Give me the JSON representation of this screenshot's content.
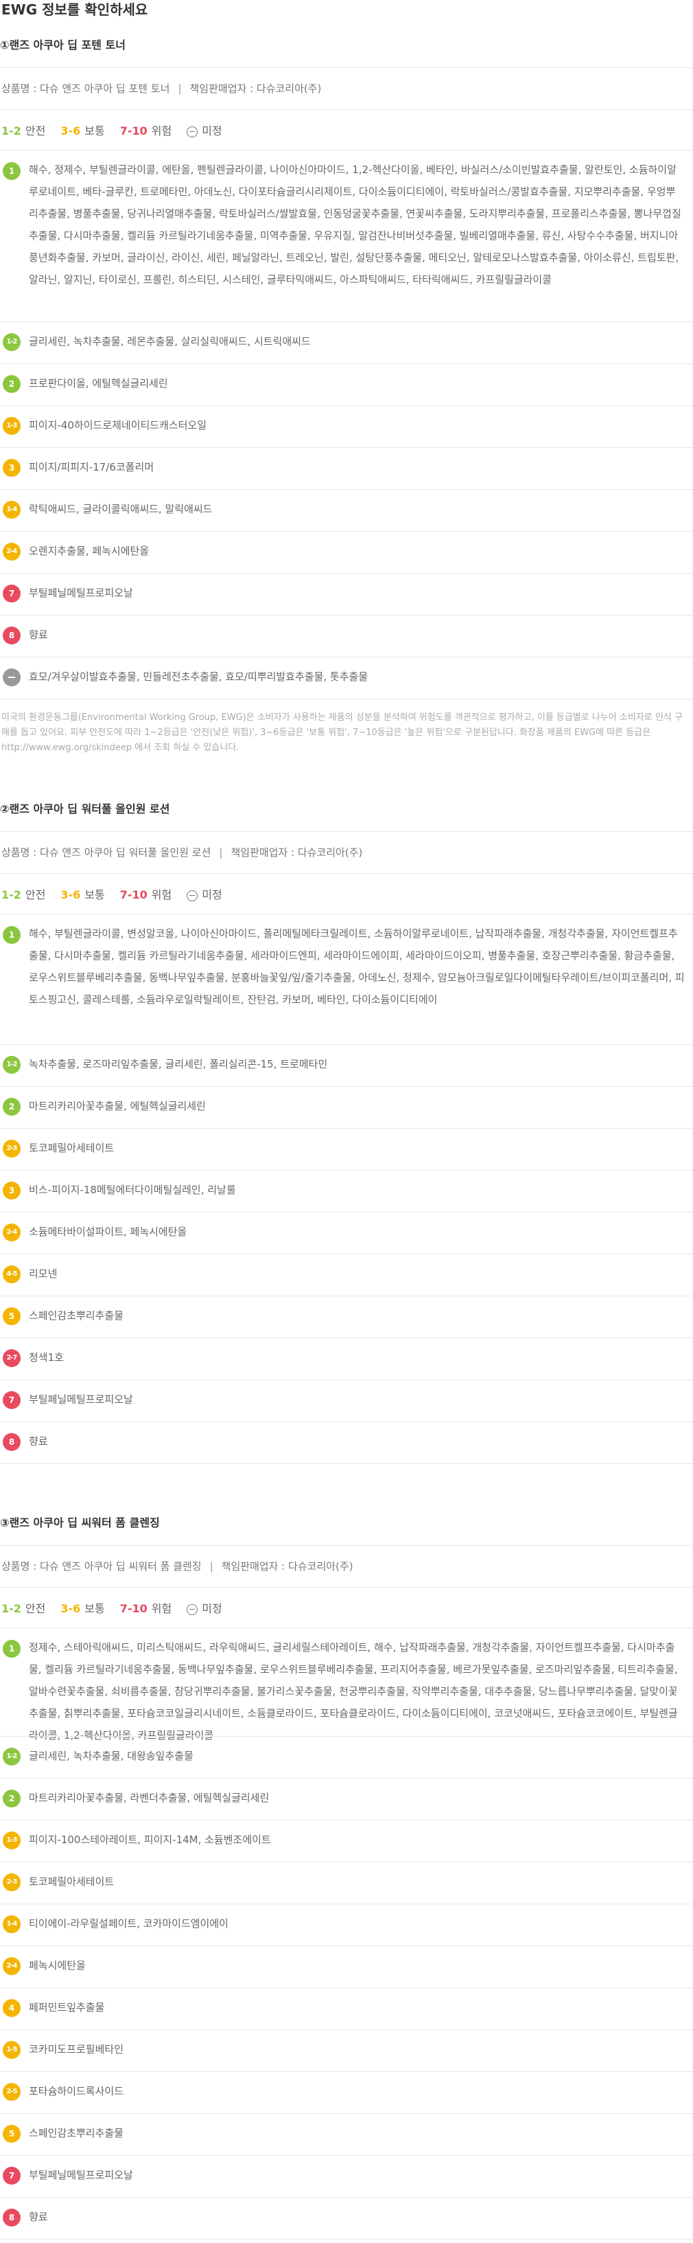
{
  "page_title": "EWG 정보를 확인하세요",
  "legend": {
    "g1": "1-2",
    "g1_label": "안전",
    "g2": "3-6",
    "g2_label": "보통",
    "g3": "7-10",
    "g3_label": "위험",
    "g4_label": "미정"
  },
  "colors": {
    "safe": "#8cc63f",
    "moderate": "#f4b400",
    "danger": "#e84a5f",
    "unknown": "#999999"
  },
  "products": [
    {
      "title": "①랜즈 아쿠아 딥 포텐 토너",
      "product_label": "상품명 : 다슈 앤즈 아쿠아 딥 포텐 토너",
      "seller_label": "책임판매업자 : 다슈코리아(주)",
      "rows": [
        {
          "grade": "1",
          "text": "해수, 정제수, 부틸렌글라이콜, 에탄올, 펜틸렌글라이콜, 나이아신아마이드, 1,2-헥산다이올, 베타인, 바실러스/소이빈발효추출물, 알란토인, 소듐하이알루로네이트, 베타-글루칸, 트로메타민, 아데노신, 다이포타슘글리시리제이트, 다이소듐이디티에이, 락토바실러스/콩발효추출물, 지모뿌리추출물, 우엉뿌리추출물, 병풀추출물, 당귀나리열매추출물, 락토바실러스/쌀발효물, 인동덩굴꽃추출물, 연꽃씨추출물, 도라지뿌리추출물, 프로폴리스추출물, 뽕나무껍질추출물, 다시마추출물, 켈리듐 카르틸라기네움추출물, 미역추출물, 우유지질, 말검잔나비버섯추출물, 빌베리열매추출물, 류신, 사탕수수추출물, 버지니아풍년화추출물, 카보머, 글라이신, 라이신, 세린, 페닐알라닌, 트레오닌, 발린, 설탕단풍추출물, 메티오닌, 알테로모나스발효추출물, 아이소류신, 트립토판, 알라닌, 알지닌, 타이로신, 프롤린, 히스티딘, 시스테인, 글루타믹애씨드, 아스파틱애씨드, 타타릭애씨드, 카프릴릴글라이콜"
        },
        {
          "grade": "1-2",
          "text": "글리세린, 녹차추출물, 레몬추출물, 살리실릭애씨드, 시트릭애씨드"
        },
        {
          "grade": "2",
          "text": "프로판다이올, 에틸헥실글리세린"
        },
        {
          "grade": "1-3",
          "text": "피이지-40하이드로제네이티드캐스터오일"
        },
        {
          "grade": "3",
          "text": "피이지/피피지-17/6코폴리머"
        },
        {
          "grade": "1-4",
          "text": "락틱애씨드, 글라이콜릭애씨드, 말릭애씨드"
        },
        {
          "grade": "2-4",
          "text": "오렌지추출물, 페녹시에탄올"
        },
        {
          "grade": "7",
          "text": "부틸페닐메틸프로피오날"
        },
        {
          "grade": "8",
          "text": "향료"
        },
        {
          "grade": "na",
          "text": "효모/겨우살이발효추출물, 민들레전초추출물, 효모/띠뿌리발효추출물, 톳추출물"
        }
      ],
      "disclaimer": "미국의 환경운동그룹(Environmental Working Group, EWG)은 소비자가 사용하는 제품의 성분을 분석하여 위험도를 객관적으로 평가하고, 이를 등급별로 나누어 소비자로 인식 구매를 돕고 있어요. 피부 안전도에 따라 1~2등급은 '안전(낮은 위험)', 3~6등급은 '보통 위험', 7~10등급은 '높은 위험'으로 구분된답니다. 화장품 제품의 EWG에 따른 등급은 http://www.ewg.org/skindeep 에서 조회 하실 수 있습니다."
    },
    {
      "title": "②랜즈 아쿠아 딥 워터풀 올인원 로션",
      "product_label": "상품명 : 다슈 앤즈 아쿠아 딥 워터풀 올인원 로션",
      "seller_label": "책임판매업자 : 다슈코리아(주)",
      "rows": [
        {
          "grade": "1",
          "text": "해수, 부틸렌글라이콜, 변성알코올, 나이아신아마이드, 폴리메틸메타크릴레이트, 소듐하이알루로네이트, 납작파래추출물, 개청각추출물, 자이언트켈프추출물, 다시마추출물, 켈리듐 카르틸라기네움추출물, 세라마이드엔피, 세라마이드에이피, 세라마이드이오피, 병풀추출물, 호장근뿌리추출물, 황금추출물, 로우스위트블루베리추출물, 동백나무잎추출물, 분홍바늘꽃잎/잎/줄기추출물, 아데노신, 정제수, 암모늄아크릴로일다이메틸타우레이트/브이피코폴리머, 피토스핑고신, 콜레스테롤, 소듐라우로일락틸레이트, 잔탄검, 카보머, 베타인, 다이소듐이디티에이"
        },
        {
          "grade": "1-2",
          "text": "녹차추출물, 로즈마리잎추출물, 글리세린, 폴리실리콘-15, 트로메타민"
        },
        {
          "grade": "2",
          "text": "마트리카리아꽃추출물, 에틸헥실글리세린"
        },
        {
          "grade": "2-3",
          "text": "토코페릴아세테이트"
        },
        {
          "grade": "3",
          "text": "비스-피이지-18메틸에터다이메틸실레인, 리날룰"
        },
        {
          "grade": "2-4",
          "text": "소듐메타바이설파이트, 페녹시에탄올"
        },
        {
          "grade": "4-5",
          "text": "리모넨"
        },
        {
          "grade": "5",
          "text": "스페인감초뿌리추출물"
        },
        {
          "grade": "2-7",
          "text": "청색1호"
        },
        {
          "grade": "7",
          "text": "부틸페닐메틸프로피오날"
        },
        {
          "grade": "8",
          "text": "향료"
        }
      ]
    },
    {
      "title": "③랜즈 아쿠아 딥 씨워터 폼 클렌징",
      "product_label": "상품명 : 다슈 앤즈 아쿠아 딥 씨워터 폼 클렌징",
      "seller_label": "책임판매업자 : 다슈코리아(주)",
      "rows": [
        {
          "grade": "1",
          "text": "정제수, 스테아릭애씨드, 미리스틱애씨드, 라우릭애씨드, 글리세릴스테아레이트, 해수, 납작파래추출물, 개청각추출물, 자이언트켈프추출물, 다시마추출물, 켈리듐 카르틸라기네움추출물, 동백나무잎추출물, 로우스위트블루베리추출물, 프리지어추출물, 베르가못잎추출물, 로즈마리잎추출물, 티트리추출물, 알바수련꽃추출물, 쇠비름추출물, 참당귀뿌리추출물, 불가리스꽃추출물, 천궁뿌리추출물, 작약뿌리추출물, 대추추출물, 당느릅나무뿌리추출물, 달맞이꽃추출물, 칡뿌리추출물, 포타슘코코일글리시네이트, 소듐클로라이드, 포타슘클로라이드, 다이소듐이디티에이, 코코넛애씨드, 포타슘코코에이트, 부틸렌글라이콜, 1,2-헥산다이올, 카프릴릴글라이콜"
        },
        {
          "grade": "1-2",
          "text": "글리세린, 녹차추출물, 대왕송잎추출물"
        },
        {
          "grade": "2",
          "text": "마트리카리아꽃추출물, 라벤더추출물, 에틸헥실글리세린"
        },
        {
          "grade": "1-3",
          "text": "피이지-100스테아레이트, 피이지-14M, 소듐벤조에이트"
        },
        {
          "grade": "2-3",
          "text": "토코페릴아세테이트"
        },
        {
          "grade": "1-4",
          "text": "티이에이-라우릴설페이트, 코카마이드엠이에이"
        },
        {
          "grade": "2-4",
          "text": "페녹시에탄올"
        },
        {
          "grade": "4",
          "text": "페퍼민트잎추출물"
        },
        {
          "grade": "1-5",
          "text": "코카미도프로필베타인"
        },
        {
          "grade": "2-5",
          "text": "포타슘하이드록사이드"
        },
        {
          "grade": "5",
          "text": "스페인감초뿌리추출물"
        },
        {
          "grade": "7",
          "text": "부틸페닐메틸프로피오날"
        },
        {
          "grade": "8",
          "text": "향료"
        }
      ]
    }
  ]
}
